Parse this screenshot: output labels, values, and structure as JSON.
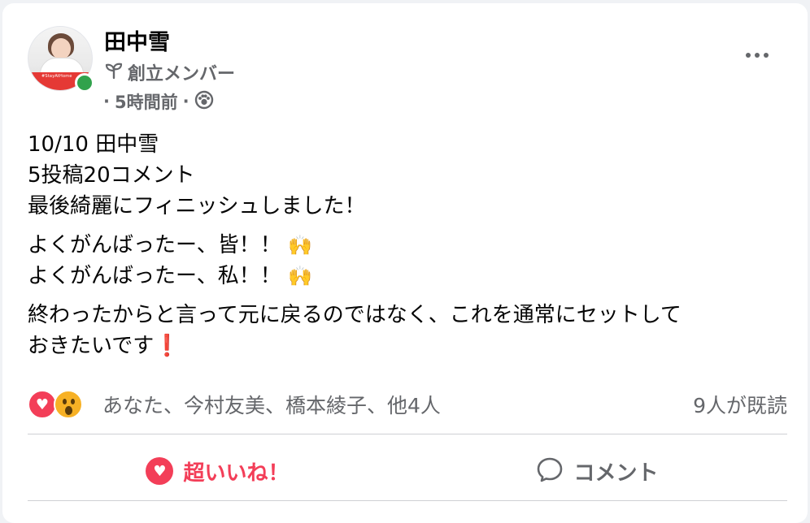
{
  "post": {
    "author_name": "田中雪",
    "badge_icon": "sprout-icon",
    "role_label": "創立メンバー",
    "timestamp": "5時間前",
    "separator": "·",
    "privacy_icon": "group-icon",
    "avatar_banner_text": "#StayAtHome"
  },
  "content": {
    "paragraphs": [
      [
        "10/10 田中雪",
        "5投稿20コメント",
        "最後綺麗にフィニッシュしました！"
      ],
      [
        "よくがんばったー、皆！！",
        "よくがんばったー、私！！"
      ],
      [
        "終わったからと言って元に戻るのではなく、これを通常にセットして",
        "おきたいです"
      ]
    ],
    "emoji_raising_hands": "🙌",
    "emoji_exclamation": "❗"
  },
  "reactions": {
    "icons": [
      "heart-icon",
      "wow-icon"
    ],
    "names": "あなた、今村友美、橋本綾子、他4人",
    "seen": "9人が既読"
  },
  "actions": {
    "like_label": "超いいね！",
    "comment_label": "コメント"
  },
  "colors": {
    "accent_red": "#f33e58",
    "secondary_text": "#65676b",
    "online_green": "#31a24c"
  }
}
